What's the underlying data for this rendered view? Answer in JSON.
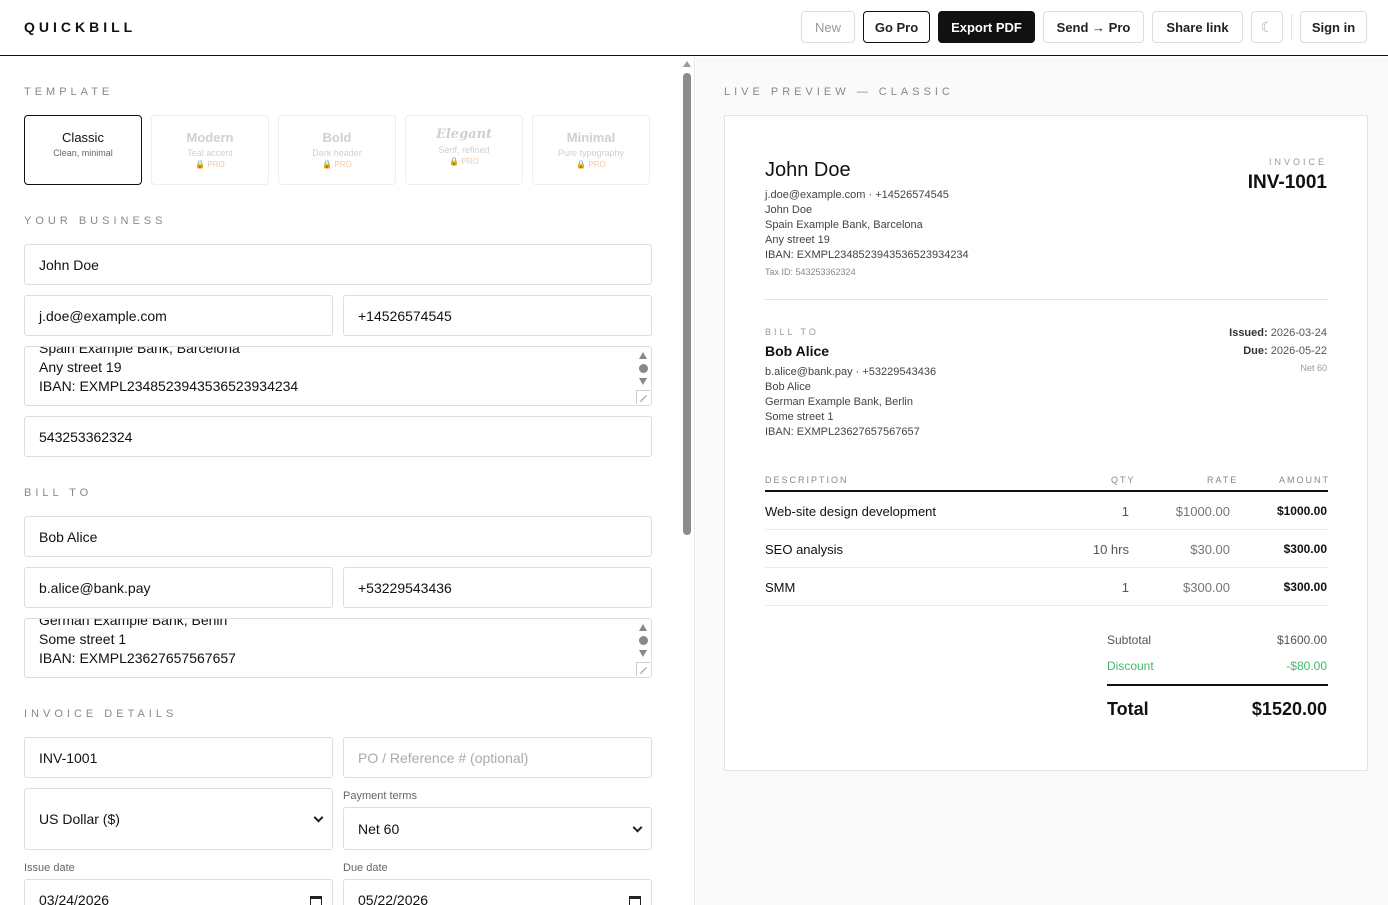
{
  "app": {
    "name": "QUICKBILL"
  },
  "header": {
    "new": "New",
    "go_pro": "Go Pro",
    "export_pdf": "Export PDF",
    "send_pro": "Send → Pro",
    "share_link": "Share link",
    "theme_icon": "☾",
    "sign_in": "Sign in"
  },
  "sections": {
    "template": "TEMPLATE",
    "your_business": "YOUR BUSINESS",
    "bill_to": "BILL TO",
    "invoice_details": "INVOICE DETAILS"
  },
  "templates": [
    {
      "name": "Classic",
      "desc": "Clean, minimal",
      "pro": "",
      "active": true
    },
    {
      "name": "Modern",
      "desc": "Teal accent",
      "pro": "🔒 PRO",
      "active": false
    },
    {
      "name": "Bold",
      "desc": "Dark header",
      "pro": "🔒 PRO",
      "active": false
    },
    {
      "name": "Elegant",
      "desc": "Serif, refined",
      "pro": "🔒 PRO",
      "active": false
    },
    {
      "name": "Minimal",
      "desc": "Pure typography",
      "pro": "🔒 PRO",
      "active": false
    }
  ],
  "business": {
    "name": "John Doe",
    "email": "j.doe@example.com",
    "phone": "+14526574545",
    "address_lines": [
      "Spain Example Bank, Barcelona",
      "Any street 19",
      "IBAN: EXMPL2348523943536523934234"
    ],
    "tax_id": "543253362324"
  },
  "client": {
    "name": "Bob Alice",
    "email": "b.alice@bank.pay",
    "phone": "+53229543436",
    "address_lines": [
      "German Example Bank, Berlin",
      "Some street 1",
      "IBAN: EXMPL23627657567657"
    ]
  },
  "details": {
    "invoice_no": "INV-1001",
    "po_placeholder": "PO / Reference # (optional)",
    "currency": "US Dollar ($)",
    "payment_terms_label": "Payment terms",
    "payment_terms": "Net 60",
    "issue_date_label": "Issue date",
    "issue_date": "03/24/2026",
    "due_date_label": "Due date",
    "due_date": "05/22/2026"
  },
  "preview": {
    "label": "LIVE PREVIEW — CLASSIC",
    "from_name": "John Doe",
    "from_contact": "j.doe@example.com · +14526574545",
    "from_lines": [
      "John Doe",
      "Spain Example Bank, Barcelona",
      "Any street 19",
      "IBAN: EXMPL2348523943536523934234"
    ],
    "tax_line": "Tax ID: 543253362324",
    "invoice_label": "INVOICE",
    "invoice_no": "INV-1001",
    "bill_to_label": "BILL TO",
    "client_name": "Bob Alice",
    "client_contact": "b.alice@bank.pay · +53229543436",
    "client_lines": [
      "Bob Alice",
      "German Example Bank, Berlin",
      "Some street 1",
      "IBAN: EXMPL23627657567657"
    ],
    "issued_label": "Issued:",
    "issued": "2026-03-24",
    "due_label": "Due:",
    "due": "2026-05-22",
    "terms": "Net 60",
    "columns": {
      "description": "DESCRIPTION",
      "qty": "QTY",
      "rate": "RATE",
      "amount": "AMOUNT"
    },
    "items": [
      {
        "description": "Web-site design development",
        "qty": "1",
        "rate": "$1000.00",
        "amount": "$1000.00"
      },
      {
        "description": "SEO analysis",
        "qty": "10 hrs",
        "rate": "$30.00",
        "amount": "$300.00"
      },
      {
        "description": "SMM",
        "qty": "1",
        "rate": "$300.00",
        "amount": "$300.00"
      }
    ],
    "subtotal_label": "Subtotal",
    "subtotal": "$1600.00",
    "discount_label": "Discount",
    "discount": "-$80.00",
    "total_label": "Total",
    "total": "$1520.00"
  }
}
